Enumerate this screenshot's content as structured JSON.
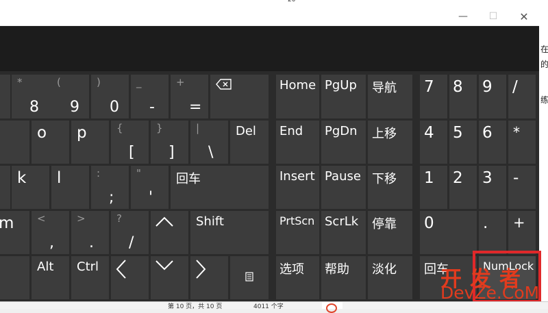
{
  "doc": {
    "ruler_mark": "20"
  },
  "window": {
    "minimize_glyph": "—",
    "maximize_glyph": "☐",
    "close_glyph": "✕"
  },
  "keys": {
    "k_star8": {
      "sec": "*",
      "pri": "8"
    },
    "k_paren9": {
      "sec": "(",
      "pri": "9"
    },
    "k_paren0": {
      "sec": ")",
      "pri": "0"
    },
    "k_minus": {
      "sec": "_",
      "pri": "-"
    },
    "k_equal": {
      "sec": "+",
      "pri": "="
    },
    "k_o": "o",
    "k_p": "p",
    "k_lbracket": {
      "sec": "{",
      "pri": "["
    },
    "k_rbracket": {
      "sec": "}",
      "pri": "]"
    },
    "k_backslash": {
      "sec": "|",
      "pri": "\\"
    },
    "k_del": "Del",
    "k_k": "k",
    "k_l": "l",
    "k_semicolon": {
      "sec": ":",
      "pri": ";"
    },
    "k_quote": {
      "sec": "\"",
      "pri": "'"
    },
    "k_enter": "回车",
    "k_m": "m",
    "k_comma": {
      "sec": "<",
      "pri": ","
    },
    "k_period": {
      "sec": ">",
      "pri": "."
    },
    "k_slash": {
      "sec": "?",
      "pri": "/"
    },
    "k_shift": "Shift",
    "k_alt": "Alt",
    "k_ctrl": "Ctrl",
    "k_home": "Home",
    "k_pgup": "PgUp",
    "k_nav": "导航",
    "k_end": "End",
    "k_pgdn": "PgDn",
    "k_moveup": "上移",
    "k_insert": "Insert",
    "k_pause": "Pause",
    "k_movedown": "下移",
    "k_prtscn": "PrtScn",
    "k_scrlk": "ScrLk",
    "k_dock": "停靠",
    "k_options": "选项",
    "k_help": "帮助",
    "k_fade": "淡化",
    "np_7": "7",
    "np_8": "8",
    "np_9": "9",
    "np_div": "/",
    "np_4": "4",
    "np_5": "5",
    "np_6": "6",
    "np_mul": "*",
    "np_1": "1",
    "np_2": "2",
    "np_3": "3",
    "np_sub": "-",
    "np_0": "0",
    "np_dot": ".",
    "np_add": "+",
    "np_enter": "回车",
    "np_numlock": "NumLock"
  },
  "side_text": [
    "在",
    "的",
    "练"
  ],
  "status_bar": {
    "page_info": "第 10 页，共 10 页",
    "word_count": "4011 个字"
  },
  "watermark": {
    "line1": "开发者",
    "line2": "DevZe.CoM"
  },
  "colors": {
    "key_bg": "#3c3c3c",
    "panel_bg": "#2b2b2b",
    "header_bg": "#1c1c1c",
    "highlight": "#e0282a"
  }
}
